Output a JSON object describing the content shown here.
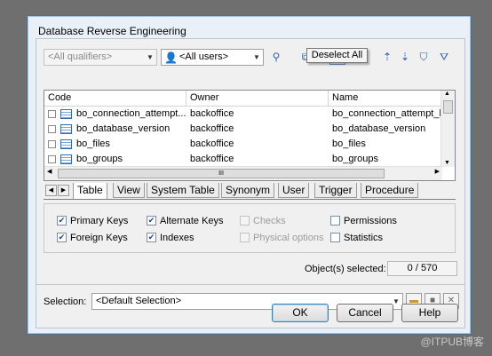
{
  "dialog": {
    "title": "Database Reverse Engineering"
  },
  "toolbar": {
    "qualifier_value": "<All qualifiers>",
    "user_value": "<All users>",
    "tooltip": "Deselect All"
  },
  "table": {
    "columns": [
      "Code",
      "Owner",
      "Name"
    ],
    "rows": [
      {
        "code": "bo_connection_attempt...",
        "owner": "backoffice",
        "name": "bo_connection_attempt_h"
      },
      {
        "code": "bo_database_version",
        "owner": "backoffice",
        "name": "bo_database_version"
      },
      {
        "code": "bo_files",
        "owner": "backoffice",
        "name": "bo_files"
      },
      {
        "code": "bo_groups",
        "owner": "backoffice",
        "name": "bo_groups"
      }
    ],
    "hscroll_label": "III"
  },
  "tabs": [
    "Table",
    "View",
    "System Table",
    "Synonym",
    "User",
    "Trigger",
    "Procedure"
  ],
  "options": {
    "primary_keys": "Primary Keys",
    "foreign_keys": "Foreign Keys",
    "alternate_keys": "Alternate Keys",
    "indexes": "Indexes",
    "checks": "Checks",
    "physical_options": "Physical options",
    "permissions": "Permissions",
    "statistics": "Statistics"
  },
  "status": {
    "label": "Object(s) selected:",
    "value": "0 / 570"
  },
  "selection": {
    "label": "Selection:",
    "value": "<Default Selection>"
  },
  "buttons": {
    "ok": "OK",
    "cancel": "Cancel",
    "help": "Help"
  },
  "watermark": "@ITPUB博客",
  "colors": {
    "accent": "#3c7fb1",
    "dialog_bg": "#e9f0f8",
    "backdrop": "#6f6f6f"
  }
}
